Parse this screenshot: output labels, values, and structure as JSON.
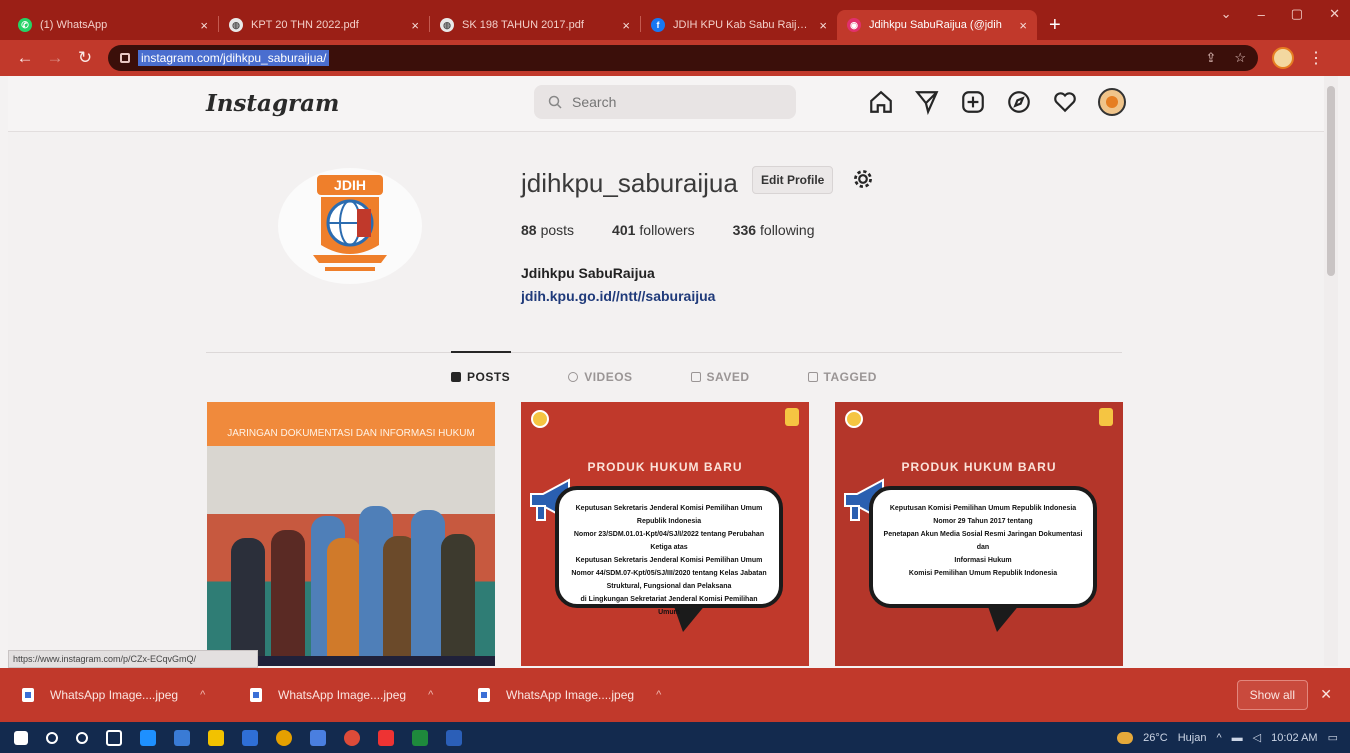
{
  "browser": {
    "tabs": [
      {
        "title": "(1) WhatsApp",
        "icon": "whatsapp-icon",
        "color": "#25d366",
        "active": false
      },
      {
        "title": "KPT 20 THN 2022.pdf",
        "icon": "globe-icon",
        "color": "#e9e9e9",
        "active": false
      },
      {
        "title": "SK 198 TAHUN 2017.pdf",
        "icon": "globe-icon",
        "color": "#e9e9e9",
        "active": false
      },
      {
        "title": "JDIH KPU Kab Sabu Raijua |",
        "icon": "facebook-icon",
        "color": "#1877f2",
        "active": false
      },
      {
        "title": "Jdihkpu SabuRaijua (@jdih",
        "icon": "instagram-icon",
        "color": "#e1306c",
        "active": true
      }
    ],
    "new_tab": "+",
    "url": "instagram.com/jdihkpu_saburaijua/"
  },
  "instagram": {
    "logo": "Instagram",
    "search_placeholder": "Search",
    "profile": {
      "username": "jdihkpu_saburaijua",
      "edit_profile": "Edit Profile",
      "posts_count": "88",
      "posts_label": "posts",
      "followers_count": "401",
      "followers_label": "followers",
      "following_count": "336",
      "following_label": "following",
      "full_name": "Jdihkpu SabuRaijua",
      "bio_link": "jdih.kpu.go.id//ntt//saburaijua"
    },
    "tabs": [
      {
        "label": "POSTS",
        "active": true
      },
      {
        "label": "VIDEOS",
        "active": false
      },
      {
        "label": "SAVED",
        "active": false
      },
      {
        "label": "TAGGED",
        "active": false
      }
    ],
    "posts": {
      "post1": {
        "banner": "JARINGAN DOKUMENTASI DAN INFORMASI HUKUM"
      },
      "post2": {
        "heading": "PRODUK HUKUM BARU",
        "lines": [
          "Keputusan Sekretaris Jenderal Komisi Pemilihan Umum Republik Indonesia",
          "Nomor 23/SDM.01.01-Kpt/04/SJ/I/2022 tentang Perubahan Ketiga atas",
          "Keputusan Sekretaris Jenderal Komisi Pemilihan Umum",
          "Nomor 44/SDM.07-Kpt/05/SJ/III/2020 tentang Kelas Jabatan Struktural, Fungsional dan Pelaksana",
          "di Lingkungan Sekretariat Jenderal Komisi Pemilihan Umum"
        ]
      },
      "post3": {
        "heading": "PRODUK HUKUM BARU",
        "lines": [
          "Keputusan Komisi Pemilihan Umum Republik Indonesia",
          "Nomor 29 Tahun 2017 tentang",
          "Penetapan Akun Media Sosial Resmi Jaringan Dokumentasi dan",
          "Informasi Hukum",
          "Komisi Pemilihan Umum Republik Indonesia"
        ]
      }
    }
  },
  "status_url": "https://www.instagram.com/p/CZx-ECqvGmQ/",
  "downloads": {
    "items": [
      {
        "name": "WhatsApp Image....jpeg"
      },
      {
        "name": "WhatsApp Image....jpeg"
      },
      {
        "name": "WhatsApp Image....jpeg"
      }
    ],
    "show_all": "Show all"
  },
  "taskbar": {
    "weather": "26°C",
    "weather_desc": "Hujan",
    "clock": "10:02 AM"
  },
  "colors": {
    "chrome_dark": "#9b1f16",
    "chrome": "#c1392b",
    "taskbar": "#132a4e"
  }
}
